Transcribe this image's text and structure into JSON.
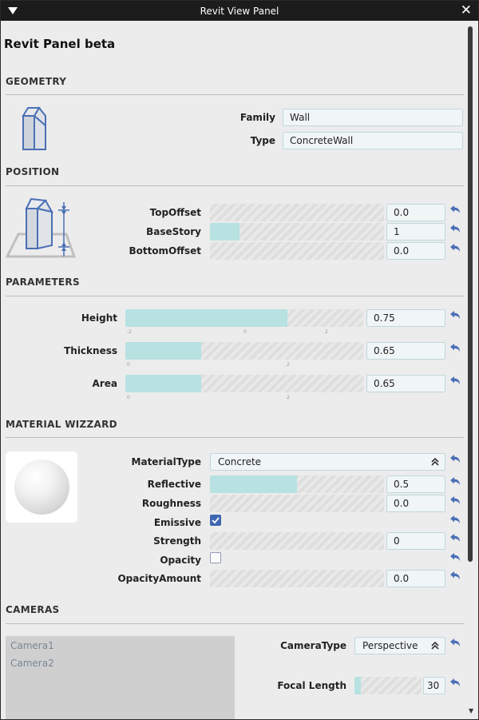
{
  "window": {
    "title": "Revit View Panel"
  },
  "panel": {
    "title": "Revit Panel beta"
  },
  "geometry": {
    "section": "GEOMETRY",
    "family_label": "Family",
    "family_value": "Wall",
    "type_label": "Type",
    "type_value": "ConcreteWall"
  },
  "position": {
    "section": "POSITION",
    "top_offset": {
      "label": "TopOffset",
      "value": "0.0",
      "level": 0
    },
    "base_story": {
      "label": "BaseStory",
      "value": "1",
      "level": 0.17
    },
    "bottom_offset": {
      "label": "BottomOffset",
      "value": "0.0",
      "level": 0
    }
  },
  "parameters": {
    "section": "PARAMETERS",
    "height": {
      "label": "Height",
      "value": "0.75",
      "level": 0.68,
      "ticks": [
        "-2",
        "0",
        "2"
      ]
    },
    "thickness": {
      "label": "Thickness",
      "value": "0.65",
      "level": 0.32,
      "ticks": [
        "0",
        "2"
      ]
    },
    "area": {
      "label": "Area",
      "value": "0.65",
      "level": 0.32,
      "ticks": [
        "0",
        "2"
      ]
    }
  },
  "material": {
    "section": "MATERIAL WIZZARD",
    "material_type": {
      "label": "MaterialType",
      "value": "Concrete"
    },
    "reflective": {
      "label": "Reflective",
      "value": "0.5",
      "level": 0.5
    },
    "roughness": {
      "label": "Roughness",
      "value": "0.0",
      "level": 0
    },
    "emissive": {
      "label": "Emissive",
      "checked": true
    },
    "strength": {
      "label": "Strength",
      "value": "0",
      "level": 0
    },
    "opacity": {
      "label": "Opacity",
      "checked": false
    },
    "opacity_amount": {
      "label": "OpacityAmount",
      "value": "0.0",
      "level": 0
    }
  },
  "cameras": {
    "section": "CAMERAS",
    "list": [
      "Camera1",
      "Camera2"
    ],
    "camera_type": {
      "label": "CameraType",
      "value": "Perspective"
    },
    "focal_length": {
      "label": "Focal Length",
      "value": "30",
      "level": 0.09
    }
  },
  "colors": {
    "accent_fill": "#b8e1e1",
    "checkbox": "#3f67b1",
    "icon_blue": "#4a6fb5",
    "titlebar": "#1c1c1c"
  }
}
